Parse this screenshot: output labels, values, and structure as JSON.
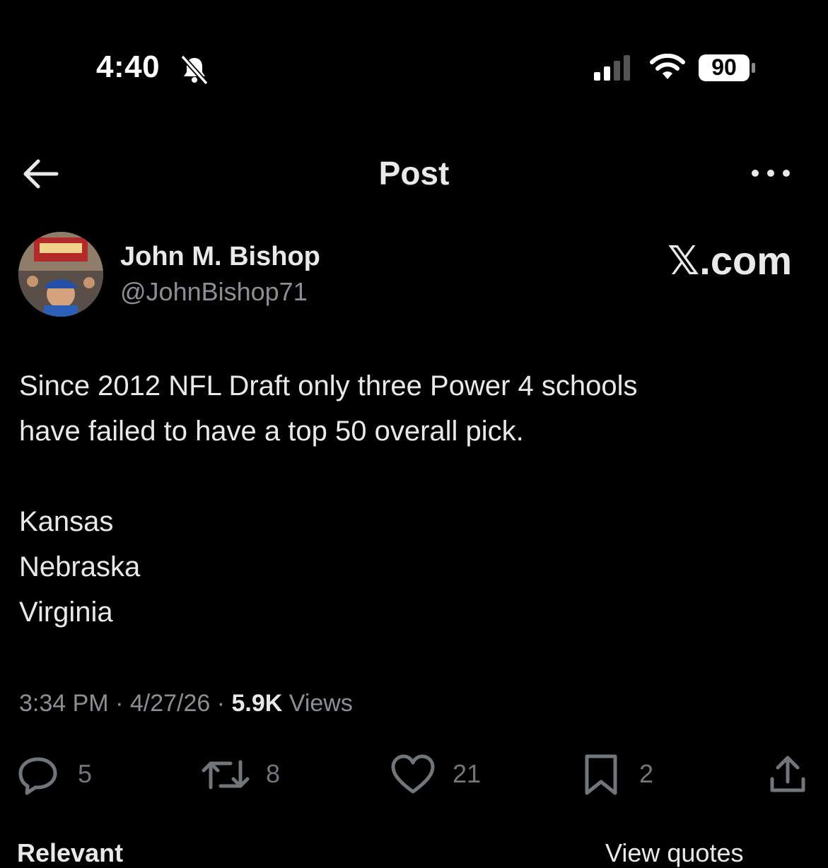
{
  "status_bar": {
    "time": "4:40",
    "battery": "90"
  },
  "header": {
    "title": "Post"
  },
  "post": {
    "author_name": "John M. Bishop",
    "author_handle": "@JohnBishop71",
    "watermark": "𝕏.com",
    "body_lines": [
      "Since 2012 NFL Draft only three Power 4 schools",
      "have failed to have a top 50 overall pick.",
      "Kansas",
      "Nebraska",
      "Virginia"
    ],
    "timestamp": "3:34 PM · 4/27/26 · ",
    "views_count": "5.9K",
    "views_label": " Views"
  },
  "actions": {
    "replies": "5",
    "reposts": "8",
    "likes": "21",
    "bookmarks": "2"
  },
  "footer_cutoff": {
    "left": "Relevant",
    "right": "View quotes"
  },
  "colors": {
    "background": "#000000",
    "text": "#e7e9ea",
    "muted": "#71767b"
  }
}
